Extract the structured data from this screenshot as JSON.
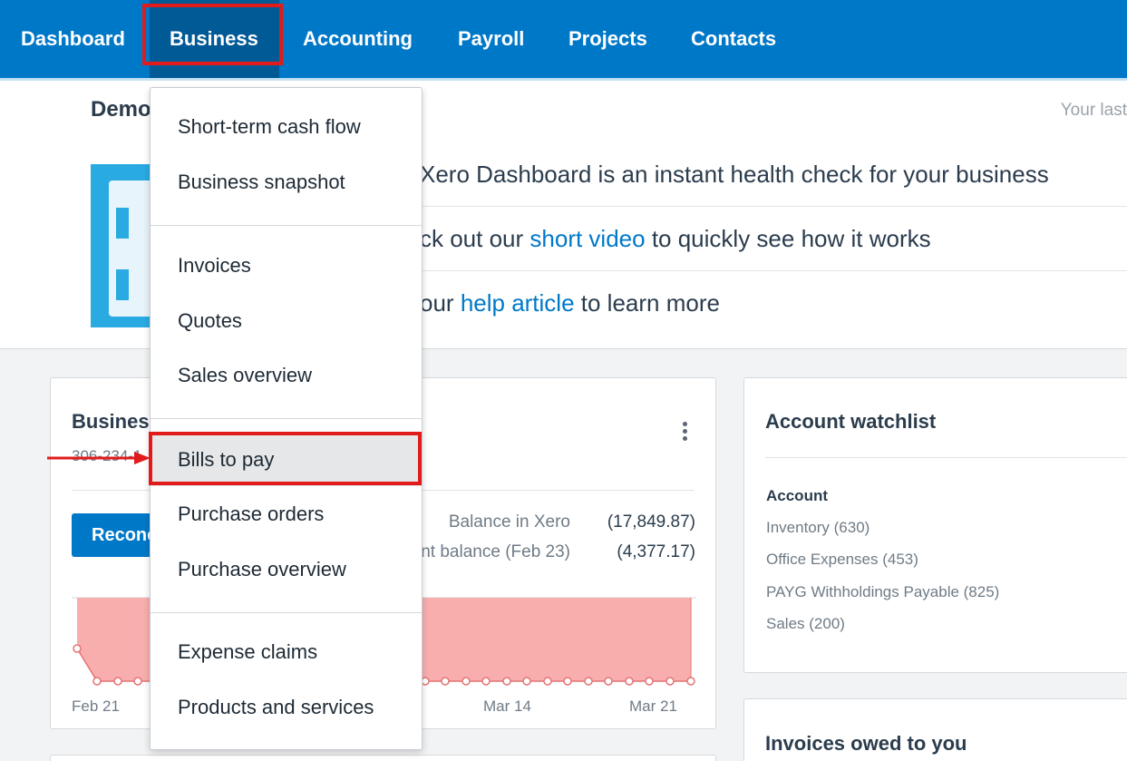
{
  "nav": {
    "items": [
      "Dashboard",
      "Business",
      "Accounting",
      "Payroll",
      "Projects",
      "Contacts"
    ],
    "active": "Business"
  },
  "banner": {
    "title_partial": "Demo",
    "last_login_partial": "Your last",
    "line1": "Xero Dashboard is an instant health check for your business",
    "line2_pre": "ck out our ",
    "line2_link": "short video",
    "line2_post": " to quickly see how it works",
    "line3_pre": "our ",
    "line3_link": "help article",
    "line3_post": " to learn more"
  },
  "bank_card": {
    "title_partial": "Busines",
    "account_partial": "306-234-1",
    "reconcile_partial": "Reconc",
    "balance_in_xero_label": "Balance in Xero",
    "balance_in_xero_value": "(17,849.87)",
    "statement_balance_label_partial": "nt balance (Feb 23)",
    "statement_balance_value": "(4,377.17)",
    "x_labels": [
      "Feb 21",
      "Mar 14",
      "Mar 21"
    ]
  },
  "watchlist": {
    "title": "Account watchlist",
    "column_header": "Account",
    "accounts": [
      "Inventory (630)",
      "Office Expenses (453)",
      "PAYG Withholdings Payable (825)",
      "Sales (200)"
    ]
  },
  "invoices_card": {
    "title": "Invoices owed to you"
  },
  "dropdown": {
    "groups": [
      [
        "Short-term cash flow",
        "Business snapshot"
      ],
      [
        "Invoices",
        "Quotes",
        "Sales overview"
      ],
      [
        "Bills to pay",
        "Purchase orders",
        "Purchase overview"
      ],
      [
        "Expense claims",
        "Products and services"
      ]
    ],
    "highlighted": "Bills to pay"
  },
  "colors": {
    "nav_bg": "#0078c8",
    "nav_active": "#005a96",
    "highlight": "#e11b1b",
    "chart_fill": "#f9aeae",
    "link": "#0078c8"
  }
}
